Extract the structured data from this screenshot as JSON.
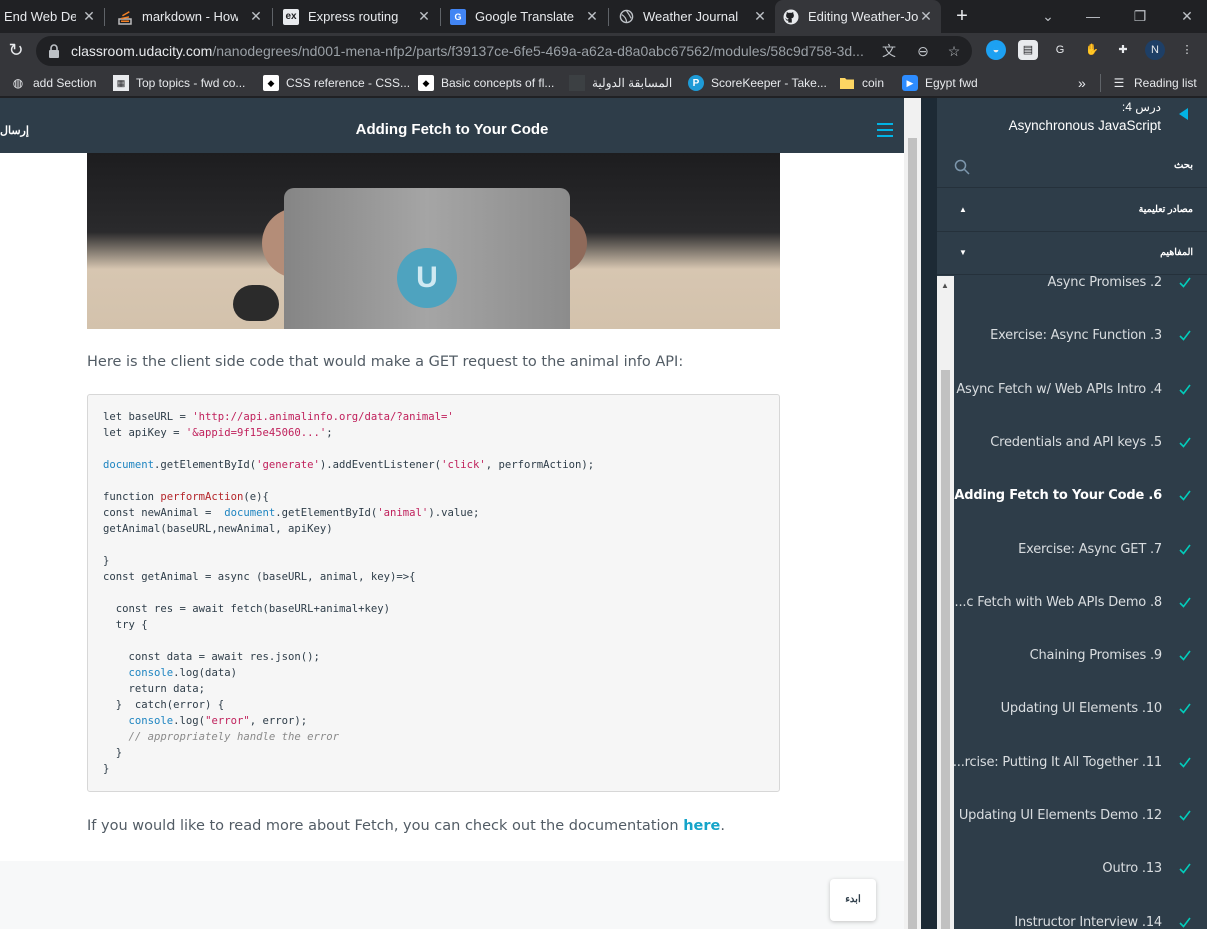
{
  "browser": {
    "tabs": [
      {
        "title": "End Web Dev",
        "icon": "udacity-icon",
        "active": false
      },
      {
        "title": "markdown - How to",
        "icon": "stackoverflow-icon",
        "active": false
      },
      {
        "title": "Express routing",
        "icon": "express-icon",
        "active": false
      },
      {
        "title": "Google Translate",
        "icon": "google-translate-icon",
        "active": false
      },
      {
        "title": "Weather Journal",
        "icon": "globe-icon",
        "active": false
      },
      {
        "title": "Editing Weather-Jo",
        "icon": "github-icon",
        "active": true
      }
    ],
    "url_host": "classroom.udacity.com",
    "url_path": "/nanodegrees/nd001-mena-nfp2/parts/f39137ce-6fe5-469a-a62a-d8a0abc67562/modules/58c9d758-3d...",
    "bookmarks": [
      {
        "label": "add Section",
        "icon": "globe-icon"
      },
      {
        "label": "Top topics - fwd co...",
        "icon": "forum-icon"
      },
      {
        "label": "CSS reference - CSS...",
        "icon": "mdn-icon"
      },
      {
        "label": "Basic concepts of fl...",
        "icon": "mdn-icon"
      },
      {
        "label": "المسابقة الدولية",
        "icon": "page-icon"
      },
      {
        "label": "ScoreKeeper - Take...",
        "icon": "p-icon"
      },
      {
        "label": "coin",
        "icon": "folder-icon"
      },
      {
        "label": "Egypt fwd",
        "icon": "zoom-icon"
      }
    ],
    "more_bookmarks": "»",
    "reading_list": "Reading list"
  },
  "header": {
    "send_label": "إرسال",
    "title": "Adding Fetch to Your Code"
  },
  "content": {
    "intro": "Here is the client side code that would make a GET request to the animal info API:",
    "outro_text": "If you would like to read more about Fetch, you can check out the documentation ",
    "outro_link": "here",
    "outro_end": ".",
    "start_button": "ابدء",
    "video_logo": "U"
  },
  "code_lines": [
    [
      {
        "t": "let baseURL = ",
        "c": "kw"
      },
      {
        "t": "'http://api.animalinfo.org/data/?animal='",
        "c": "str"
      }
    ],
    [
      {
        "t": "let apiKey = ",
        "c": "kw"
      },
      {
        "t": "'&appid=9f15e45060...'",
        "c": "str"
      },
      {
        "t": ";",
        "c": "kw"
      }
    ],
    [],
    [
      {
        "t": "document",
        "c": "obj"
      },
      {
        "t": ".getElementById(",
        "c": "kw"
      },
      {
        "t": "'generate'",
        "c": "str"
      },
      {
        "t": ").addEventListener(",
        "c": "kw"
      },
      {
        "t": "'click'",
        "c": "str"
      },
      {
        "t": ", performAction);",
        "c": "kw"
      }
    ],
    [],
    [
      {
        "t": "function ",
        "c": "kw"
      },
      {
        "t": "performAction",
        "c": "fn"
      },
      {
        "t": "(e){",
        "c": "kw"
      }
    ],
    [
      {
        "t": "const newAnimal =  ",
        "c": "kw"
      },
      {
        "t": "document",
        "c": "obj"
      },
      {
        "t": ".getElementById(",
        "c": "kw"
      },
      {
        "t": "'animal'",
        "c": "str"
      },
      {
        "t": ").value;",
        "c": "kw"
      }
    ],
    [
      {
        "t": "getAnimal(baseURL,newAnimal, apiKey)",
        "c": "kw"
      }
    ],
    [],
    [
      {
        "t": "}",
        "c": "kw"
      }
    ],
    [
      {
        "t": "const getAnimal = async (baseURL, animal, key)=>{",
        "c": "kw"
      }
    ],
    [],
    [
      {
        "t": "  const res = await fetch(baseURL+animal+key)",
        "c": "kw"
      }
    ],
    [
      {
        "t": "  try {",
        "c": "kw"
      }
    ],
    [],
    [
      {
        "t": "    const data = await res.json();",
        "c": "kw"
      }
    ],
    [
      {
        "t": "    ",
        "c": "kw"
      },
      {
        "t": "console",
        "c": "obj"
      },
      {
        "t": ".log(data)",
        "c": "kw"
      }
    ],
    [
      {
        "t": "    return data;",
        "c": "kw"
      }
    ],
    [
      {
        "t": "  }  catch(error) {",
        "c": "kw"
      }
    ],
    [
      {
        "t": "    ",
        "c": "kw"
      },
      {
        "t": "console",
        "c": "obj"
      },
      {
        "t": ".log(",
        "c": "kw"
      },
      {
        "t": "\"error\"",
        "c": "str"
      },
      {
        "t": ", error);",
        "c": "kw"
      }
    ],
    [
      {
        "t": "    ",
        "c": "kw"
      },
      {
        "t": "// appropriately handle the error",
        "c": "cm"
      }
    ],
    [
      {
        "t": "  }",
        "c": "kw"
      }
    ],
    [
      {
        "t": "}",
        "c": "kw"
      }
    ]
  ],
  "sidebar": {
    "lesson_num": ":درس 4",
    "lesson_name": "Asynchronous JavaScript",
    "search_label": "بحث",
    "resources_label": "مصادر تعليمية",
    "concepts_label": "المفاهيم",
    "concepts": [
      {
        "title": "Async Promises .2",
        "done": true,
        "active": false
      },
      {
        "title": "Exercise: Async Function .3",
        "done": true,
        "active": false
      },
      {
        "title": "Async Fetch w/ Web APIs Intro .4",
        "done": true,
        "active": false
      },
      {
        "title": "Credentials and API keys .5",
        "done": true,
        "active": false
      },
      {
        "title": "Adding Fetch to Your Code .6",
        "done": true,
        "active": true
      },
      {
        "title": "Exercise: Async GET .7",
        "done": true,
        "active": false
      },
      {
        "title": "...c Fetch with Web APIs Demo .8",
        "done": true,
        "active": false
      },
      {
        "title": "Chaining Promises .9",
        "done": true,
        "active": false
      },
      {
        "title": "Updating UI Elements .10",
        "done": true,
        "active": false
      },
      {
        "title": "...rcise: Putting It All Together .11",
        "done": true,
        "active": false
      },
      {
        "title": "Updating UI Elements Demo .12",
        "done": true,
        "active": false
      },
      {
        "title": "Outro .13",
        "done": true,
        "active": false
      },
      {
        "title": "Instructor Interview .14",
        "done": true,
        "active": false
      }
    ]
  },
  "colors": {
    "header_bg": "#2e3d49",
    "accent": "#02b3e4",
    "check": "#02ccba"
  }
}
